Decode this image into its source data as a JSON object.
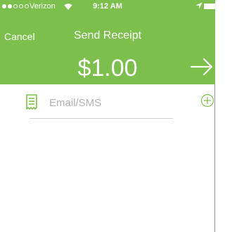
{
  "status_bar": {
    "carrier": "Verizon",
    "time": "9:12 AM",
    "signal_bars_filled": 2,
    "signal_bars_total": 5,
    "wifi_icon": "wifi-icon",
    "location_icon": "location-arrow-icon",
    "battery_icon": "battery-icon"
  },
  "navbar": {
    "cancel_label": "Cancel",
    "title": "Send Receipt"
  },
  "amount": {
    "value": "$1.00",
    "send_icon": "arrow-right-icon"
  },
  "recipient": {
    "icon": "receipt-icon",
    "value": "",
    "placeholder": "Email/SMS",
    "add_icon": "add-circle-icon"
  },
  "colors": {
    "header_bg": "#7dbf4d",
    "accent": "#7dbf4d",
    "placeholder": "#b3b3b3",
    "divider": "#cfcfcf"
  }
}
